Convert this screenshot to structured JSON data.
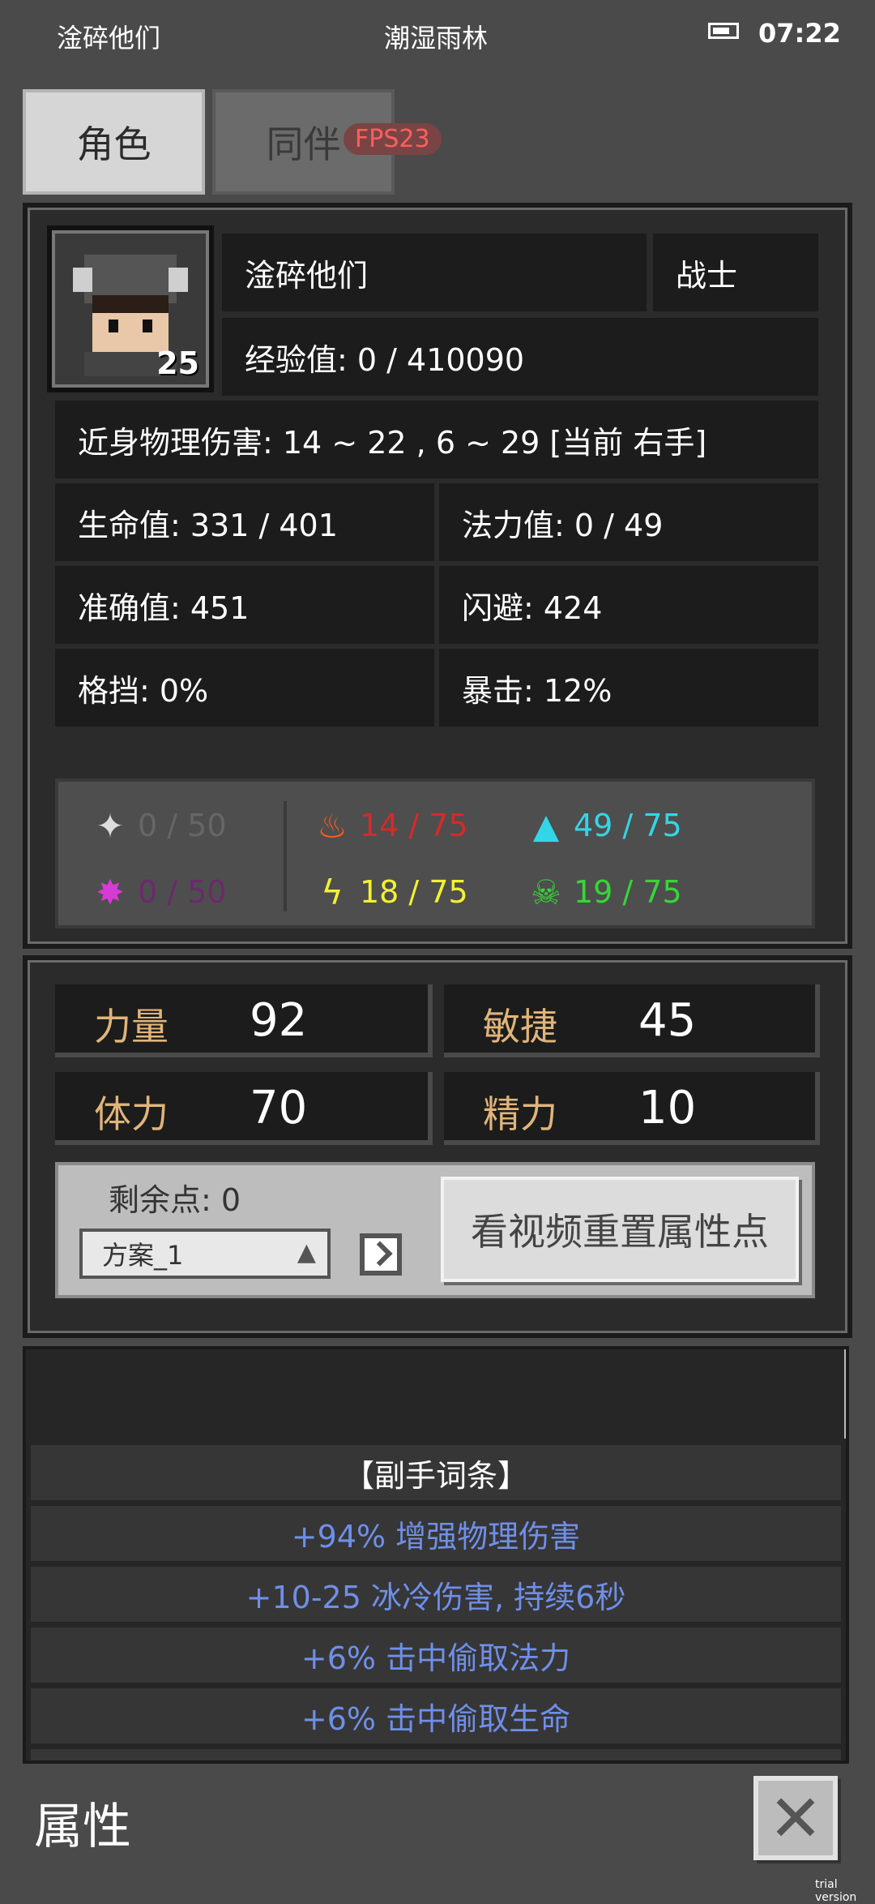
{
  "status": {
    "player": "淦碎他们",
    "location": "潮湿雨林",
    "time": "07:22"
  },
  "tabs": [
    {
      "label": "角色"
    },
    {
      "label": "同伴"
    }
  ],
  "fps": "FPS23",
  "character": {
    "name": "淦碎他们",
    "class": "战士",
    "level": "25",
    "exp": "经验值: 0 / 410090",
    "damage": "近身物理伤害: 14 ~ 22 , 6 ~ 29 [当前 右手]",
    "hp": "生命值: 331 / 401",
    "mp": "法力值: 0 / 49",
    "accuracy": "准确值: 451",
    "dodge": "闪避: 424",
    "block": "格挡: 0%",
    "crit": "暴击: 12%"
  },
  "resistances": {
    "physical": {
      "text": "0 / 50",
      "color": "#666666",
      "icon": "shuriken-icon"
    },
    "fire": {
      "text": "14 / 75",
      "color": "#d52a2a",
      "icon": "fire-icon"
    },
    "cold": {
      "text": "49 / 75",
      "color": "#33d6e6",
      "icon": "ice-icon"
    },
    "arcane": {
      "text": "0 / 50",
      "color": "#6a2a6a",
      "icon": "arcane-icon"
    },
    "lightning": {
      "text": "18 / 75",
      "color": "#f2f230",
      "icon": "lightning-icon"
    },
    "poison": {
      "text": "19 / 75",
      "color": "#37d637",
      "icon": "poison-skull-icon"
    }
  },
  "attributes": {
    "strength": {
      "label": "力量",
      "value": "92"
    },
    "agility": {
      "label": "敏捷",
      "value": "45"
    },
    "stamina": {
      "label": "体力",
      "value": "70"
    },
    "energy": {
      "label": "精力",
      "value": "10"
    }
  },
  "points": {
    "remaining": "剩余点: 0",
    "plan": "方案_1",
    "reset_label": "看视频重置属性点"
  },
  "affixes": {
    "header": "【副手词条】",
    "items": [
      "+94% 增强物理伤害",
      "+10-25 冰冷伤害, 持续6秒",
      "+6% 击中偷取法力",
      "+6% 击中偷取生命"
    ]
  },
  "footer": {
    "title": "属性",
    "close_icon": "close-icon",
    "watermark": "trial version"
  }
}
